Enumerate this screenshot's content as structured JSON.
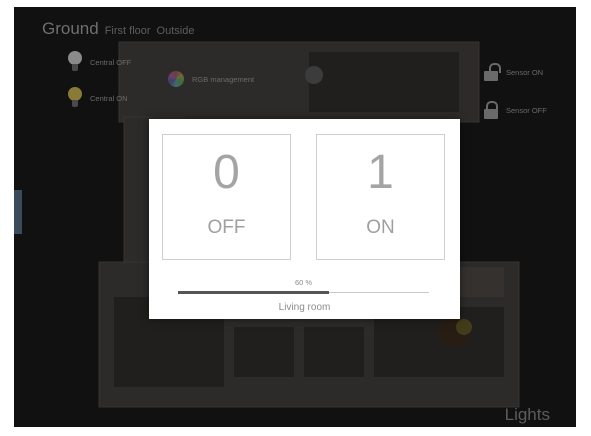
{
  "floors": {
    "active": "Ground",
    "others": [
      "First floor",
      "Outside"
    ]
  },
  "controls": {
    "central_off": "Central OFF",
    "central_on": "Central ON",
    "rgb": "RGB management",
    "sensor_on": "Sensor ON",
    "sensor_off": "Sensor OFF"
  },
  "section_label": "Lights",
  "dialog": {
    "off_button": {
      "value": "0",
      "label": "OFF"
    },
    "on_button": {
      "value": "1",
      "label": "ON"
    },
    "dimmer": {
      "percent_text": "60 %",
      "level": 0.6
    },
    "room": "Living room"
  },
  "colors": {
    "bulb_off": "#8a8a8a",
    "bulb_on": "#8a7a38",
    "backdrop": "#1c1c1c"
  },
  "icons": [
    "bulb-icon",
    "rgb-wheel-icon",
    "lock-open-icon",
    "lock-closed-icon"
  ]
}
